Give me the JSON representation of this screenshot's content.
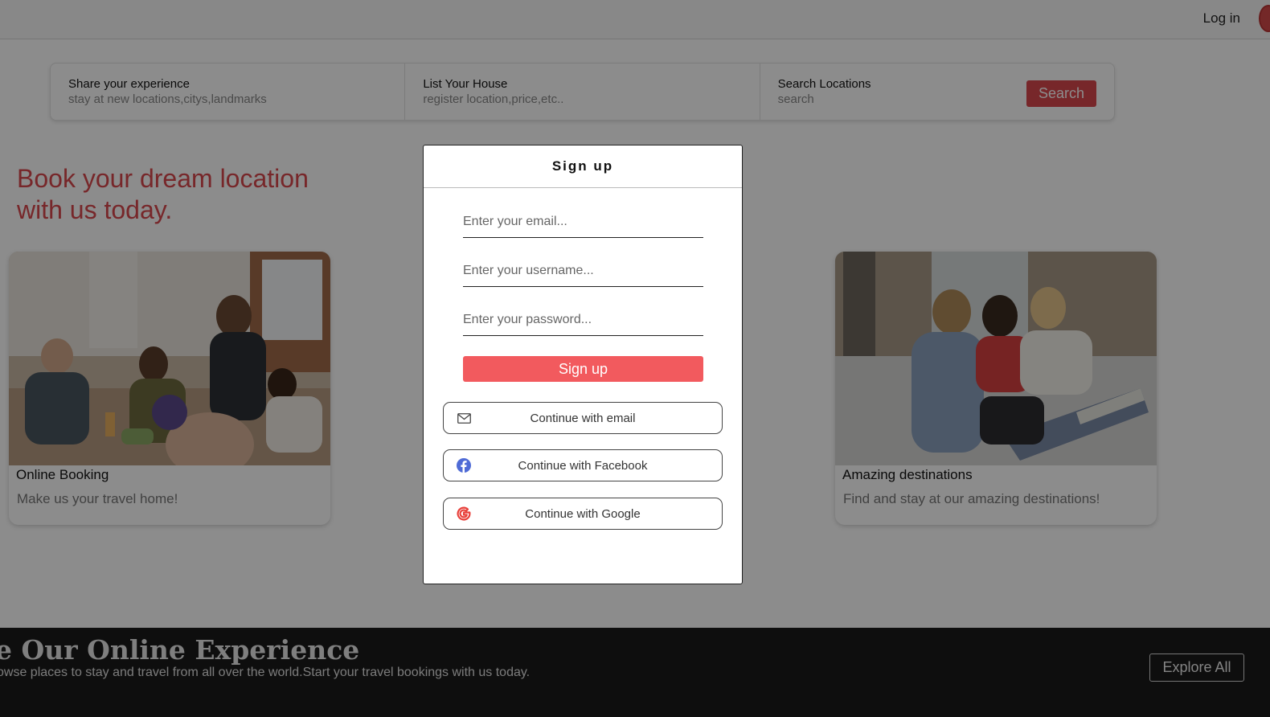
{
  "header": {
    "login_label": "Log in"
  },
  "search_bar": {
    "sections": [
      {
        "title": "Share your experience",
        "subtitle": "stay at new locations,citys,landmarks"
      },
      {
        "title": "List Your House",
        "subtitle": "register location,price,etc.."
      },
      {
        "title": "Search Locations",
        "subtitle": "search"
      }
    ],
    "search_button": "Search"
  },
  "hero": {
    "title": "Book your dream location with us today."
  },
  "cards": [
    {
      "title": "Online Booking",
      "text": "Make us your travel home!",
      "image_icon": "friends-dining-photo"
    },
    {
      "title": "Amazing destinations",
      "text": "Find and stay at our amazing destinations!",
      "image_icon": "friends-reading-photo"
    }
  ],
  "band": {
    "title": "e Our Online Experience",
    "subtitle": "owse places to stay and travel from all over the world.Start your travel bookings with us today.",
    "explore_label": "Explore All"
  },
  "modal": {
    "title": "Sign up",
    "email_placeholder": "Enter your email...",
    "username_placeholder": "Enter your username...",
    "password_placeholder": "Enter your password...",
    "signup_label": "Sign up",
    "social": [
      {
        "label": "Continue with email",
        "icon": "mail-icon"
      },
      {
        "label": "Continue with Facebook",
        "icon": "facebook-icon"
      },
      {
        "label": "Continue with Google",
        "icon": "google-icon"
      }
    ]
  },
  "colors": {
    "accent": "#d9474d",
    "signup_button": "#f25a5e",
    "facebook": "#4f6bd6",
    "google": "#e8403a"
  }
}
